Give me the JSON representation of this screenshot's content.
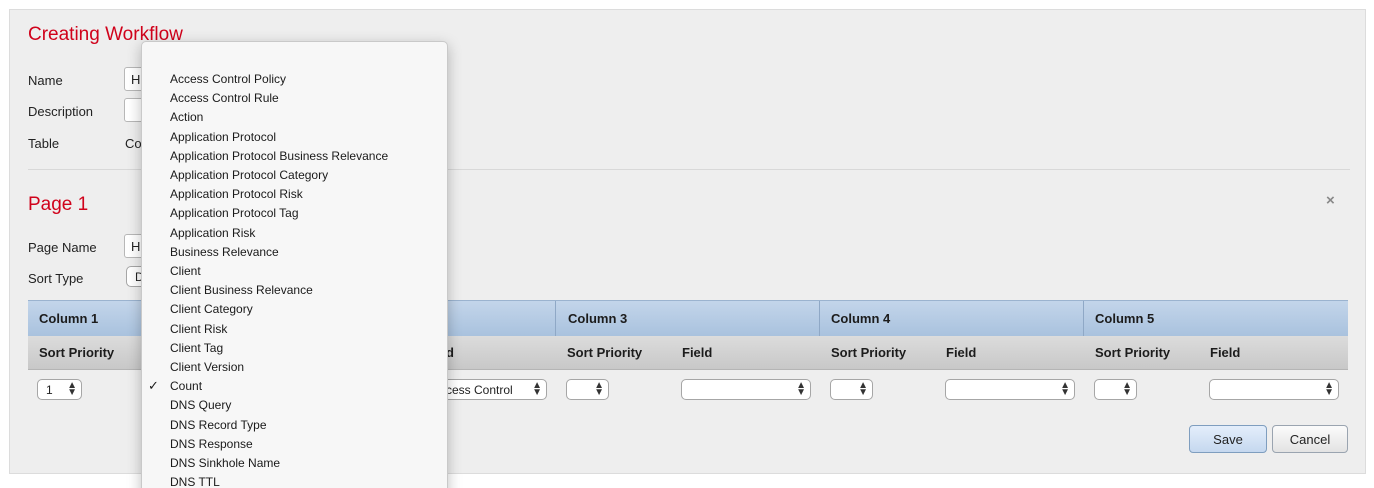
{
  "workflow": {
    "title": "Creating Workflow",
    "name_label": "Name",
    "name_value": "Hi",
    "description_label": "Description",
    "description_value": "",
    "table_label": "Table",
    "table_value": "Co"
  },
  "page": {
    "title": "Page 1",
    "page_name_label": "Page Name",
    "page_name_value": "Hi",
    "sort_type_label": "Sort Type",
    "sort_type_value": "D",
    "close_glyph": "×"
  },
  "columns": {
    "headers": [
      "Column 1",
      "Column 3",
      "Column 4",
      "Column 5"
    ],
    "sort_priority_label": "Sort Priority",
    "field_label": "Field",
    "field_label_partial": "d",
    "col1_sort_value": "1",
    "col2_field_value": "cess Control"
  },
  "buttons": {
    "save": "Save",
    "cancel": "Cancel"
  },
  "dropdown": {
    "check_glyph": "✓",
    "selected_index": 16,
    "items": [
      "Access Control Policy",
      "Access Control Rule",
      "Action",
      "Application Protocol",
      "Application Protocol Business Relevance",
      "Application Protocol Category",
      "Application Protocol Risk",
      "Application Protocol Tag",
      "Application Risk",
      "Business Relevance",
      "Client",
      "Client Business Relevance",
      "Client Category",
      "Client Risk",
      "Client Tag",
      "Client Version",
      "Count",
      "DNS Query",
      "DNS Record Type",
      "DNS Response",
      "DNS Sinkhole Name",
      "DNS TTL"
    ]
  }
}
